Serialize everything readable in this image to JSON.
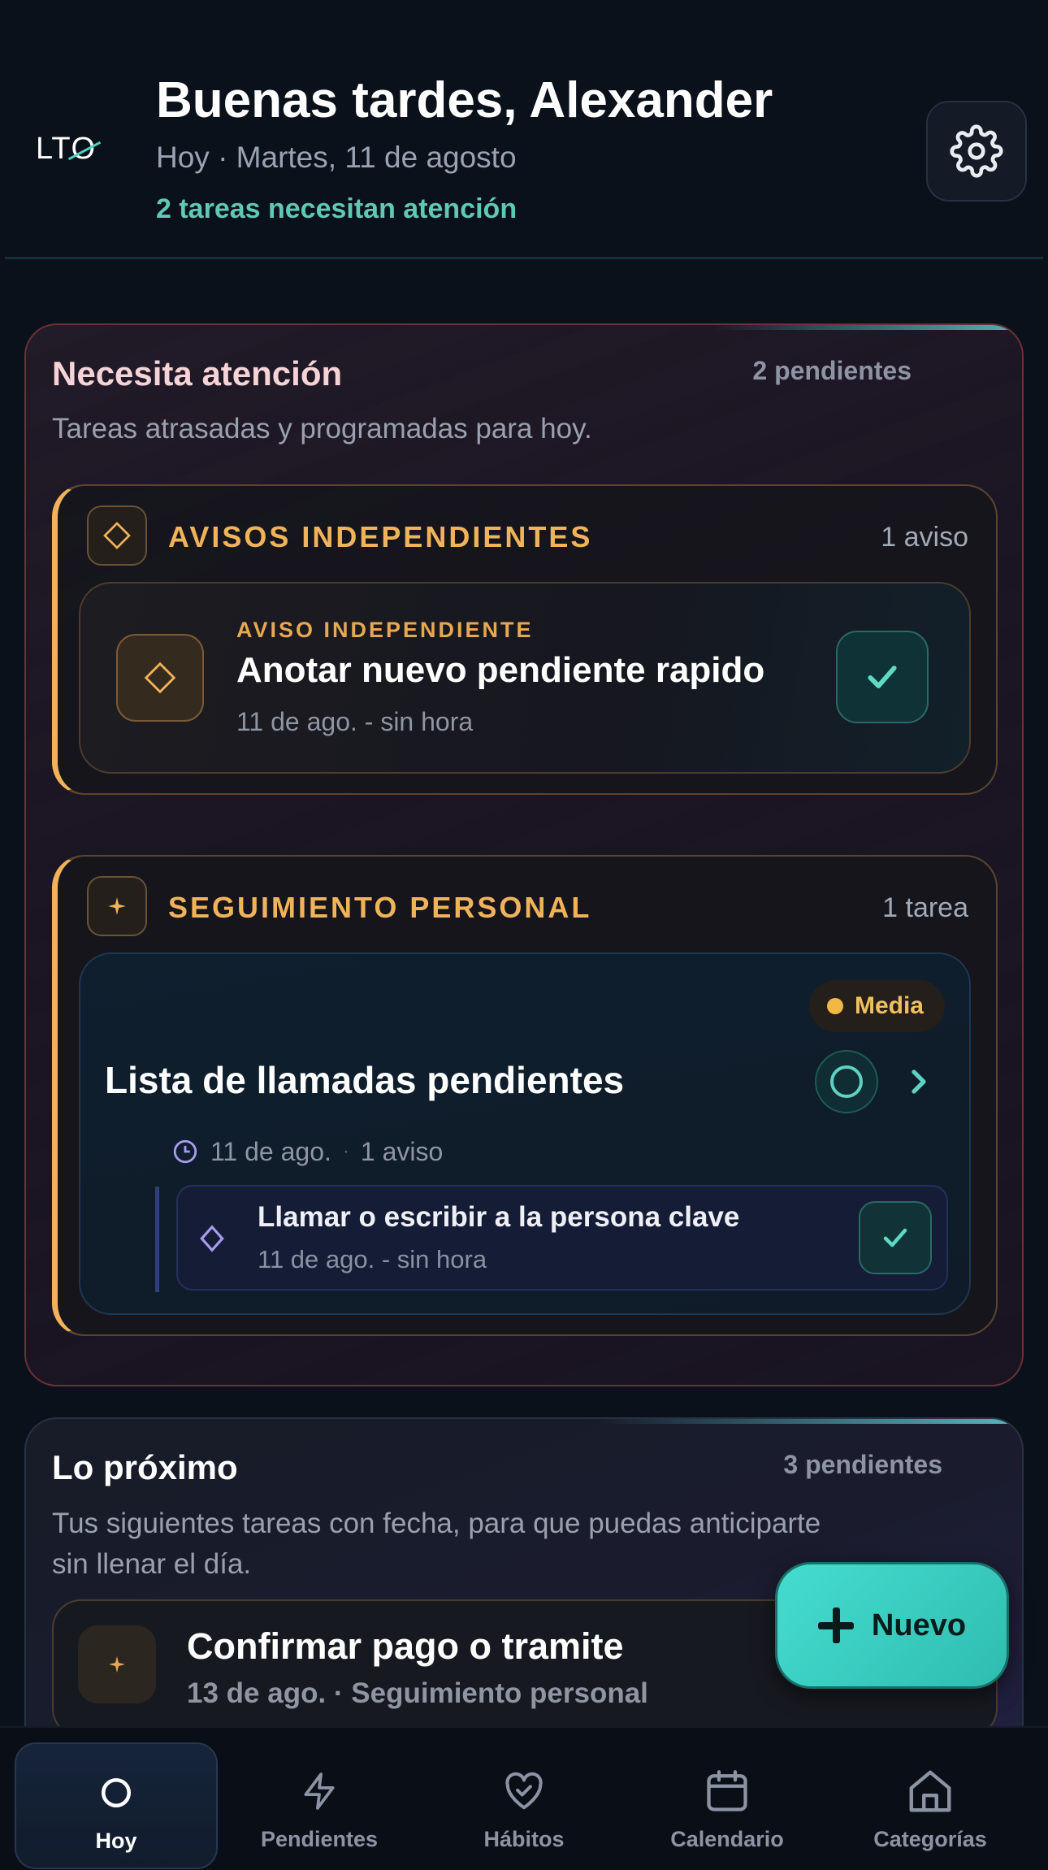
{
  "header": {
    "logo": "LTO",
    "greeting": "Buenas tardes, Alexander",
    "date": "Hoy · Martes, 11 de agosto",
    "attention": "2 tareas necesitan atención"
  },
  "attention_section": {
    "title": "Necesita atención",
    "count": "2 pendientes",
    "subtitle": "Tareas atrasadas y programadas para hoy.",
    "avisos_group": {
      "title": "AVISOS INDEPENDIENTES",
      "count": "1 aviso",
      "item": {
        "kicker": "AVISO INDEPENDIENTE",
        "title": "Anotar nuevo pendiente rapido",
        "meta": "11 de ago. - sin hora"
      }
    },
    "seguimiento_group": {
      "title": "SEGUIMIENTO PERSONAL",
      "count": "1 tarea",
      "task": {
        "priority": "Media",
        "title": "Lista de llamadas pendientes",
        "date": "11 de ago.",
        "separator": "·",
        "avisos": "1 aviso",
        "subitem": {
          "title": "Llamar o escribir a la persona clave",
          "meta": "11 de ago. - sin hora"
        }
      }
    }
  },
  "next_section": {
    "title": "Lo próximo",
    "count": "3 pendientes",
    "subtitle": "Tus siguientes tareas con fecha, para que puedas anticiparte sin llenar el día.",
    "item": {
      "title": "Confirmar pago o tramite",
      "meta": "13 de ago. · Seguimiento personal"
    }
  },
  "fab": {
    "label": "Nuevo"
  },
  "nav": [
    {
      "label": "Hoy",
      "icon": "circle-icon",
      "active": true
    },
    {
      "label": "Pendientes",
      "icon": "bolt-icon",
      "active": false
    },
    {
      "label": "Hábitos",
      "icon": "heart-check-icon",
      "active": false
    },
    {
      "label": "Calendario",
      "icon": "calendar-icon",
      "active": false
    },
    {
      "label": "Categorías",
      "icon": "home-icon",
      "active": false
    }
  ],
  "colors": {
    "accent_teal": "#5fc9b5",
    "accent_amber": "#f0b35a",
    "background": "#0b111a",
    "attention_border": "#6b3237"
  }
}
